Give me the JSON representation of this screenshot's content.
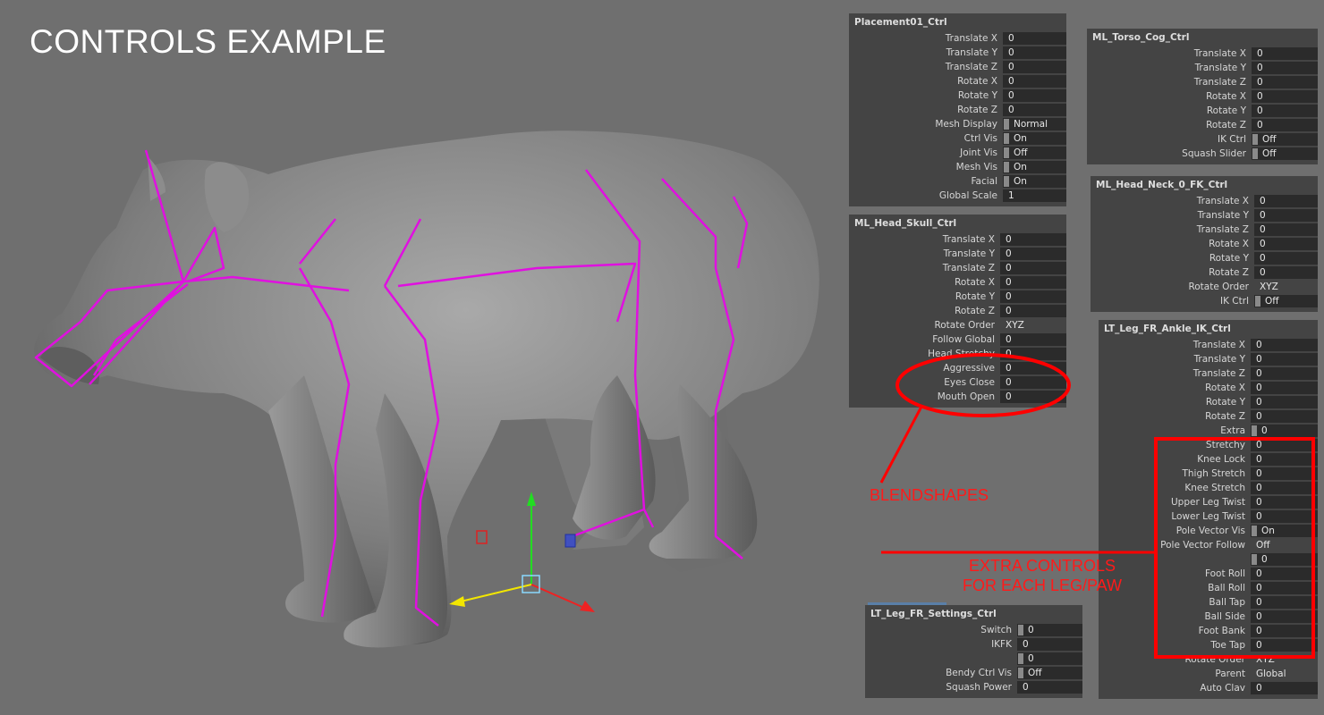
{
  "title": "CONTROLS EXAMPLE",
  "annotations": {
    "blendshapes": "BLENDSHAPES",
    "extra_line1": "EXTRA CONTROLS",
    "extra_line2": "FOR EACH LEG/PAW",
    "color": "#ff0000"
  },
  "colors": {
    "rig_curves": "#e010e0",
    "panel_bg": "#444444",
    "field_bg": "#2b2b2b",
    "viewport_bg": "#6f6f6f"
  },
  "panels": {
    "placement": {
      "title": "Placement01_Ctrl",
      "rows": [
        [
          "Translate X",
          "0"
        ],
        [
          "Translate Y",
          "0"
        ],
        [
          "Translate Z",
          "0"
        ],
        [
          "Rotate X",
          "0"
        ],
        [
          "Rotate Y",
          "0"
        ],
        [
          "Rotate Z",
          "0"
        ],
        [
          "Mesh Display",
          "Normal"
        ],
        [
          "Ctrl Vis",
          "On"
        ],
        [
          "Joint Vis",
          "Off"
        ],
        [
          "Mesh Vis",
          "On"
        ],
        [
          "Facial",
          "On"
        ],
        [
          "Global Scale",
          "1"
        ]
      ]
    },
    "head_skull": {
      "title": "ML_Head_Skull_Ctrl",
      "rows": [
        [
          "Translate X",
          "0"
        ],
        [
          "Translate Y",
          "0"
        ],
        [
          "Translate Z",
          "0"
        ],
        [
          "Rotate X",
          "0"
        ],
        [
          "Rotate Y",
          "0"
        ],
        [
          "Rotate Z",
          "0"
        ],
        [
          "Rotate Order",
          "XYZ"
        ],
        [
          "Follow Global",
          "0"
        ],
        [
          "Head Stretchy",
          "0"
        ],
        [
          "Aggressive",
          "0"
        ],
        [
          "Eyes Close",
          "0"
        ],
        [
          "Mouth Open",
          "0"
        ]
      ]
    },
    "torso": {
      "title": "ML_Torso_Cog_Ctrl",
      "rows": [
        [
          "Translate X",
          "0"
        ],
        [
          "Translate Y",
          "0"
        ],
        [
          "Translate Z",
          "0"
        ],
        [
          "Rotate X",
          "0"
        ],
        [
          "Rotate Y",
          "0"
        ],
        [
          "Rotate Z",
          "0"
        ],
        [
          "IK Ctrl",
          "Off"
        ],
        [
          "Squash Slider",
          "Off"
        ]
      ]
    },
    "head_neck": {
      "title": "ML_Head_Neck_0_FK_Ctrl",
      "rows": [
        [
          "Translate X",
          "0"
        ],
        [
          "Translate Y",
          "0"
        ],
        [
          "Translate Z",
          "0"
        ],
        [
          "Rotate X",
          "0"
        ],
        [
          "Rotate Y",
          "0"
        ],
        [
          "Rotate Z",
          "0"
        ],
        [
          "Rotate Order",
          "XYZ"
        ],
        [
          "IK Ctrl",
          "Off"
        ]
      ]
    },
    "ankle": {
      "title": "LT_Leg_FR_Ankle_IK_Ctrl",
      "rows": [
        [
          "Translate X",
          "0"
        ],
        [
          "Translate Y",
          "0"
        ],
        [
          "Translate Z",
          "0"
        ],
        [
          "Rotate X",
          "0"
        ],
        [
          "Rotate Y",
          "0"
        ],
        [
          "Rotate Z",
          "0"
        ],
        [
          "Extra",
          "0"
        ],
        [
          "Stretchy",
          "0"
        ],
        [
          "Knee Lock",
          "0"
        ],
        [
          "Thigh Stretch",
          "0"
        ],
        [
          "Knee Stretch",
          "0"
        ],
        [
          "Upper Leg Twist",
          "0"
        ],
        [
          "Lower Leg Twist",
          "0"
        ],
        [
          "Pole Vector Vis",
          "On"
        ],
        [
          "Pole Vector Follow",
          "Off"
        ],
        [
          "",
          "0"
        ],
        [
          "Foot Roll",
          "0"
        ],
        [
          "Ball Roll",
          "0"
        ],
        [
          "Ball Tap",
          "0"
        ],
        [
          "Ball Side",
          "0"
        ],
        [
          "Foot Bank",
          "0"
        ],
        [
          "Toe Tap",
          "0"
        ],
        [
          "Rotate Order",
          "XYZ"
        ],
        [
          "Parent",
          "Global"
        ],
        [
          "Auto Clav",
          "0"
        ]
      ]
    },
    "settings": {
      "title": "LT_Leg_FR_Settings_Ctrl",
      "rows": [
        [
          "Switch",
          "0"
        ],
        [
          "IKFK",
          "0"
        ],
        [
          "",
          "0"
        ],
        [
          "Bendy Ctrl Vis",
          "Off"
        ],
        [
          "Squash Power",
          "0"
        ]
      ]
    }
  }
}
